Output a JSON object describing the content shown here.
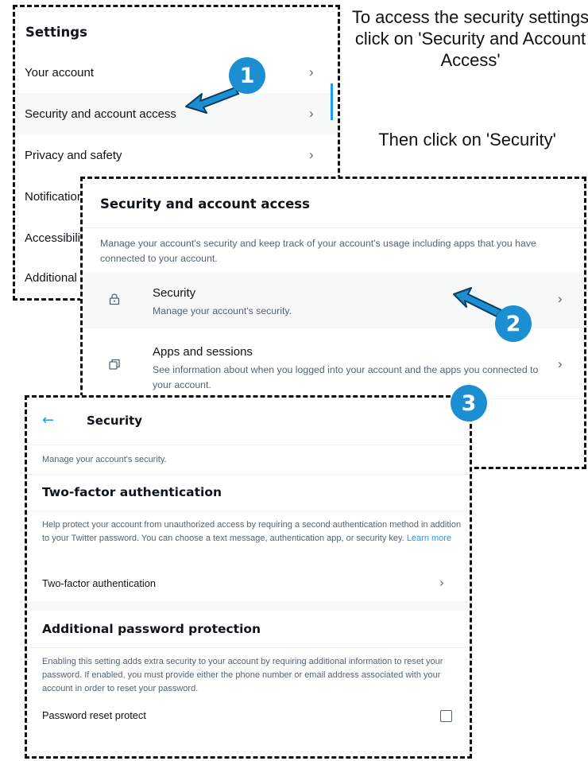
{
  "instructions": {
    "line1": "To access the security settings click on 'Security and Account Access'",
    "line2": "Then click on 'Security'"
  },
  "badges": [
    "1",
    "2",
    "3"
  ],
  "settings_panel": {
    "title": "Settings",
    "items": [
      {
        "label": "Your account"
      },
      {
        "label": "Security and account access"
      },
      {
        "label": "Privacy and safety"
      },
      {
        "label": "Notifications"
      },
      {
        "label": "Accessibility, display, and languages"
      },
      {
        "label": "Additional resources"
      }
    ]
  },
  "security_access_panel": {
    "title": "Security and account access",
    "description": "Manage your account's security and keep track of your account's usage including apps that you have connected to your account.",
    "items": [
      {
        "title": "Security",
        "subtitle": "Manage your account's security.",
        "icon": "lock-icon"
      },
      {
        "title": "Apps and sessions",
        "subtitle": "See information about when you logged into your account and the apps you connected to your account.",
        "icon": "apps-icon"
      }
    ]
  },
  "security_panel": {
    "back_icon": "back-arrow-icon",
    "title": "Security",
    "subtitle": "Manage your account's security.",
    "two_factor": {
      "heading": "Two-factor authentication",
      "description": "Help protect your account from unauthorized access by requiring a second authentication method in addition to your Twitter password. You can choose a text message, authentication app, or security key.",
      "link": "Learn more",
      "row_label": "Two-factor authentication"
    },
    "password_protection": {
      "heading": "Additional password protection",
      "description": "Enabling this setting adds extra security to your account by requiring additional information to reset your password. If enabled, you must provide either the phone number or email address associated with your account in order to reset your password.",
      "row_label": "Password reset protect"
    }
  },
  "colors": {
    "accent": "#1d9bf0",
    "badge": "#1b8fd2",
    "secondary_text": "#536471"
  }
}
